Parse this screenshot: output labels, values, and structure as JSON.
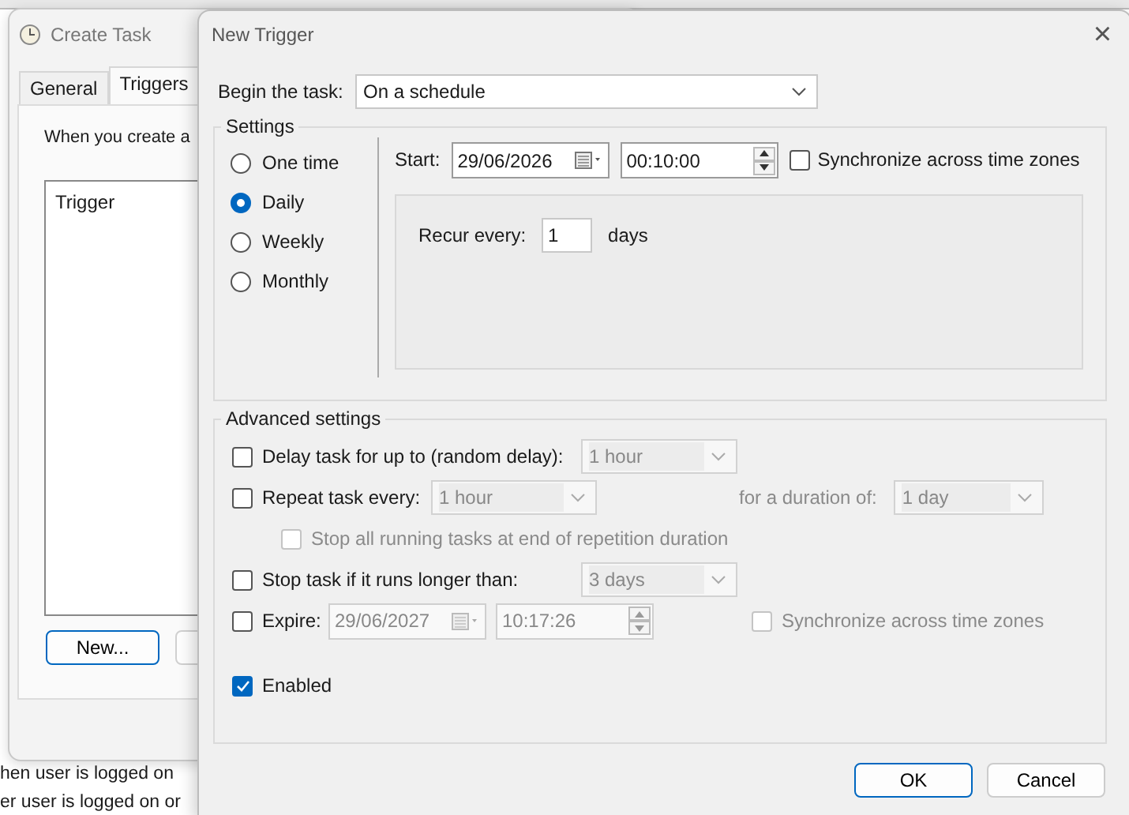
{
  "background_window": {
    "title": "Create Task",
    "tabs": [
      {
        "label": "General",
        "selected": false
      },
      {
        "label": "Triggers",
        "selected": true
      }
    ],
    "description": "When you create a",
    "list_columns": [
      "Trigger"
    ],
    "buttons": [
      "New..."
    ]
  },
  "desktop_texts": [
    "hen user is logged on",
    "er user is logged on or"
  ],
  "dialog": {
    "title": "New Trigger",
    "close": "×",
    "begin_label": "Begin the task:",
    "begin_value": "On a schedule",
    "settings": {
      "legend": "Settings",
      "schedule_options": [
        {
          "label": "One time",
          "selected": false
        },
        {
          "label": "Daily",
          "selected": true
        },
        {
          "label": "Weekly",
          "selected": false
        },
        {
          "label": "Monthly",
          "selected": false
        }
      ],
      "start_label": "Start:",
      "start_date": "29/06/2026",
      "start_time": "00:10:00",
      "sync": {
        "label": "Synchronize across time zones",
        "checked": false,
        "disabled": false
      },
      "recur_label": "Recur every:",
      "recur_value": "1",
      "recur_unit": "days"
    },
    "advanced": {
      "legend": "Advanced settings",
      "rows": [
        {
          "kind": "combo",
          "label": "Delay task for up to (random delay):",
          "checked": false,
          "disabled": false,
          "value": "1 hour",
          "value_disabled": true
        },
        {
          "kind": "repeat",
          "label": "Repeat task every:",
          "checked": false,
          "disabled": false,
          "value": "1 hour",
          "value_disabled": true,
          "duration_label": "for a duration of:",
          "duration_value": "1 day"
        },
        {
          "kind": "sub",
          "label": "Stop all running tasks at end of repetition duration",
          "checked": false,
          "disabled": true
        },
        {
          "kind": "combo",
          "label": "Stop task if it runs longer than:",
          "checked": false,
          "disabled": false,
          "value": "3 days",
          "value_disabled": true
        },
        {
          "kind": "expire",
          "label": "Expire:",
          "checked": false,
          "disabled": false,
          "date": "29/06/2027",
          "time": "10:17:26",
          "value_disabled": true,
          "sync": {
            "label": "Synchronize across time zones",
            "checked": false,
            "disabled": true
          }
        },
        {
          "kind": "enabled",
          "label": "Enabled",
          "checked": true,
          "disabled": false
        }
      ]
    },
    "buttons": [
      {
        "label": "OK",
        "default": true
      },
      {
        "label": "Cancel",
        "default": false
      }
    ]
  }
}
